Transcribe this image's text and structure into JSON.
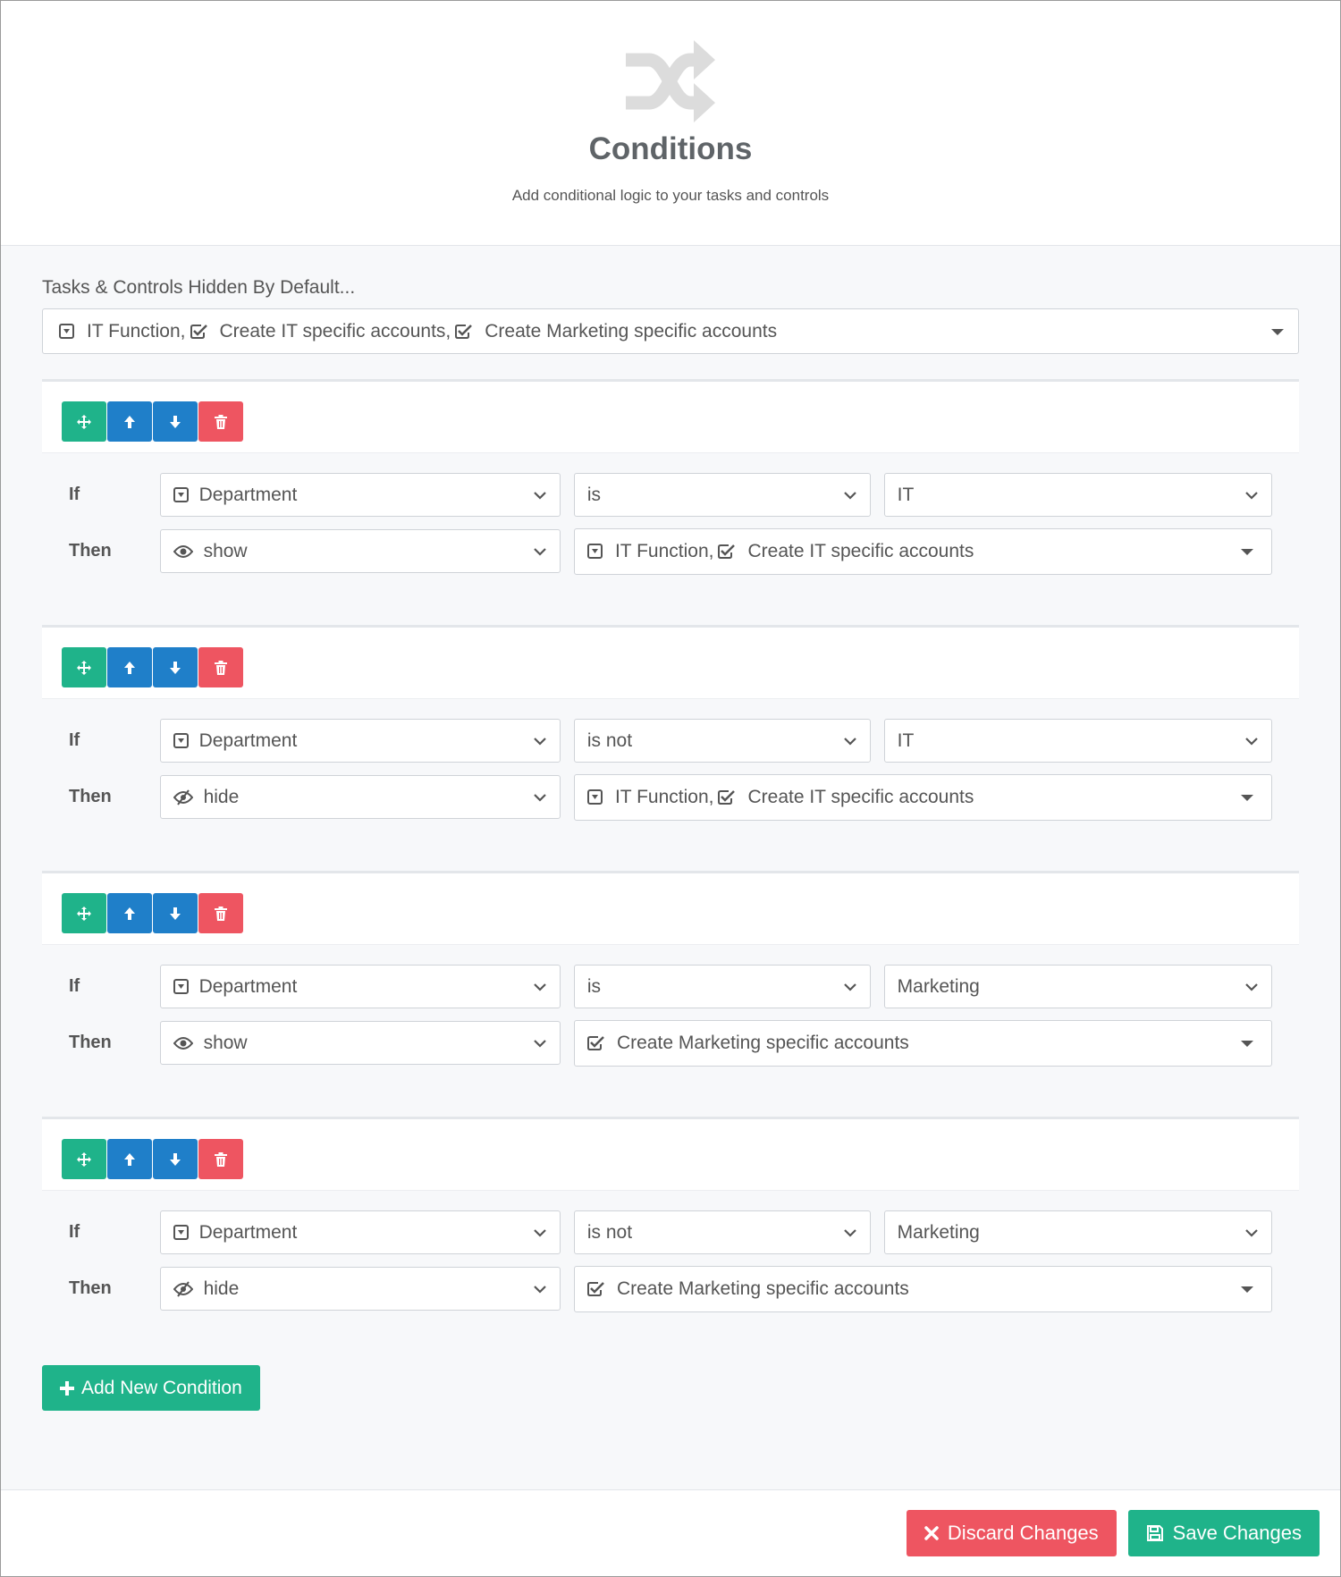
{
  "colors": {
    "primary_green": "#1fb38a",
    "primary_blue": "#1f7fc9",
    "danger_red": "#ee5561",
    "header_icon": "#dcdcdc"
  },
  "header": {
    "icon": "shuffle-icon",
    "title": "Conditions",
    "subtitle": "Add conditional logic to your tasks and controls"
  },
  "hidden_by_default": {
    "label": "Tasks & Controls Hidden By Default...",
    "items": [
      {
        "icon": "dropdown-field-icon",
        "label": "IT Function"
      },
      {
        "icon": "checkbox-icon",
        "label": "Create IT specific accounts"
      },
      {
        "icon": "checkbox-icon",
        "label": "Create Marketing specific accounts"
      }
    ]
  },
  "labels": {
    "if": "If",
    "then": "Then"
  },
  "conditions": [
    {
      "field": "Department",
      "operator": "is",
      "value": "IT",
      "action": "show",
      "action_icon": "eye-icon",
      "targets": [
        {
          "icon": "dropdown-field-icon",
          "label": "IT Function"
        },
        {
          "icon": "checkbox-icon",
          "label": "Create IT specific accounts"
        }
      ]
    },
    {
      "field": "Department",
      "operator": "is not",
      "value": "IT",
      "action": "hide",
      "action_icon": "eye-slash-icon",
      "targets": [
        {
          "icon": "dropdown-field-icon",
          "label": "IT Function"
        },
        {
          "icon": "checkbox-icon",
          "label": "Create IT specific accounts"
        }
      ]
    },
    {
      "field": "Department",
      "operator": "is",
      "value": "Marketing",
      "action": "show",
      "action_icon": "eye-icon",
      "targets": [
        {
          "icon": "checkbox-icon",
          "label": "Create Marketing specific accounts"
        }
      ]
    },
    {
      "field": "Department",
      "operator": "is not",
      "value": "Marketing",
      "action": "hide",
      "action_icon": "eye-slash-icon",
      "targets": [
        {
          "icon": "checkbox-icon",
          "label": "Create Marketing specific accounts"
        }
      ]
    }
  ],
  "buttons": {
    "add_condition": "Add New Condition",
    "discard": "Discard Changes",
    "save": "Save Changes"
  }
}
